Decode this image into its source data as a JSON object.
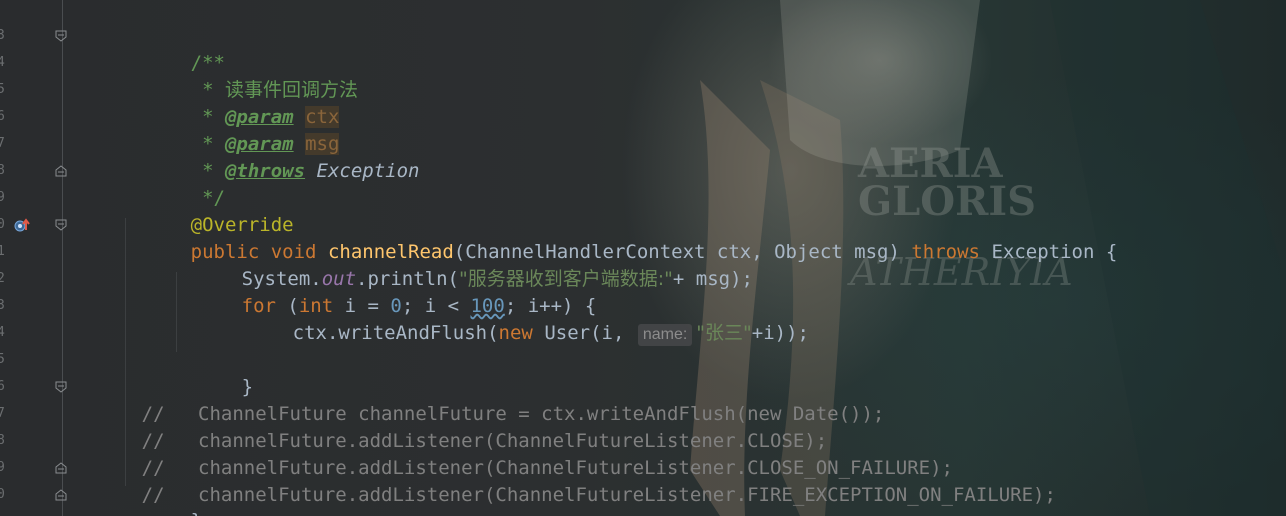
{
  "gutter": {
    "line_numbers": [
      "3",
      "4",
      "5",
      "6",
      "7",
      "8",
      "9",
      "0",
      "1",
      "2",
      "3",
      "4",
      "5",
      "6",
      "7",
      "8",
      "9",
      "0"
    ]
  },
  "watermark": {
    "line1": "AERIA",
    "line2": "GLORIS",
    "signature": "ATHERIYIA"
  },
  "code": {
    "doc_open": "/**",
    "doc_star": " * ",
    "doc_desc": "读事件回调方法",
    "param_tag": "@param",
    "param1": "ctx",
    "param2": "msg",
    "throws_tag": "@throws",
    "throws_val": "Exception",
    "doc_close": " */",
    "annotation": "@Override",
    "kw_public": "public",
    "kw_void": "void",
    "method_name": "channelRead",
    "sig_open": "(ChannelHandlerContext ctx, Object msg) ",
    "kw_throws": "throws",
    "sig_close": " Exception {",
    "sys": "System.",
    "out": "out",
    "println_open": ".println(",
    "println_str": "\"服务器收到客户端数据:\"",
    "println_close": "+ msg);",
    "kw_for": "for",
    "for_open": " (",
    "kw_int": "int",
    "for_init": " i = ",
    "zero": "0",
    "for_cond": "; i < ",
    "hundred": "100",
    "for_rest": "; i++) {",
    "write_open": "ctx.writeAndFlush(",
    "kw_new": "new",
    "user_open": " User(i, ",
    "hint_name": "name:",
    "user_str": "\"张三\"",
    "user_close": "+i));",
    "close_brace_inner": "}",
    "comment_prefix": "//",
    "comment1": "ChannelFuture channelFuture = ctx.writeAndFlush(new Date());",
    "comment2": "channelFuture.addListener(ChannelFutureListener.CLOSE);",
    "comment3": "channelFuture.addListener(ChannelFutureListener.CLOSE_ON_FAILURE);",
    "comment4": "channelFuture.addListener(ChannelFutureListener.FIRE_EXCEPTION_ON_FAILURE);",
    "close_brace_method": "}"
  }
}
